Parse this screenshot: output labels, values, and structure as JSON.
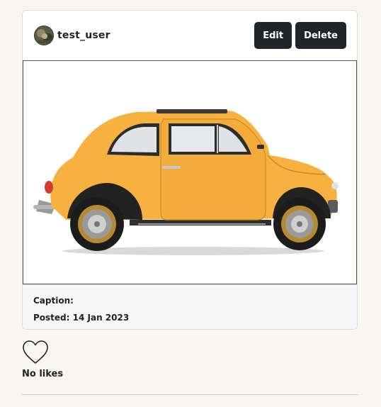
{
  "post": {
    "username": "test_user",
    "edit_label": "Edit",
    "delete_label": "Delete",
    "caption_label": "Caption:",
    "caption_value": "",
    "posted_label": "Posted:",
    "posted_date": "14 Jan 2023"
  },
  "likes": {
    "text": "No likes",
    "icon": "heart-outline-icon"
  },
  "colors": {
    "page_bg": "#f8f6f1",
    "button_bg": "#212529",
    "car_body": "#f6b13f"
  }
}
